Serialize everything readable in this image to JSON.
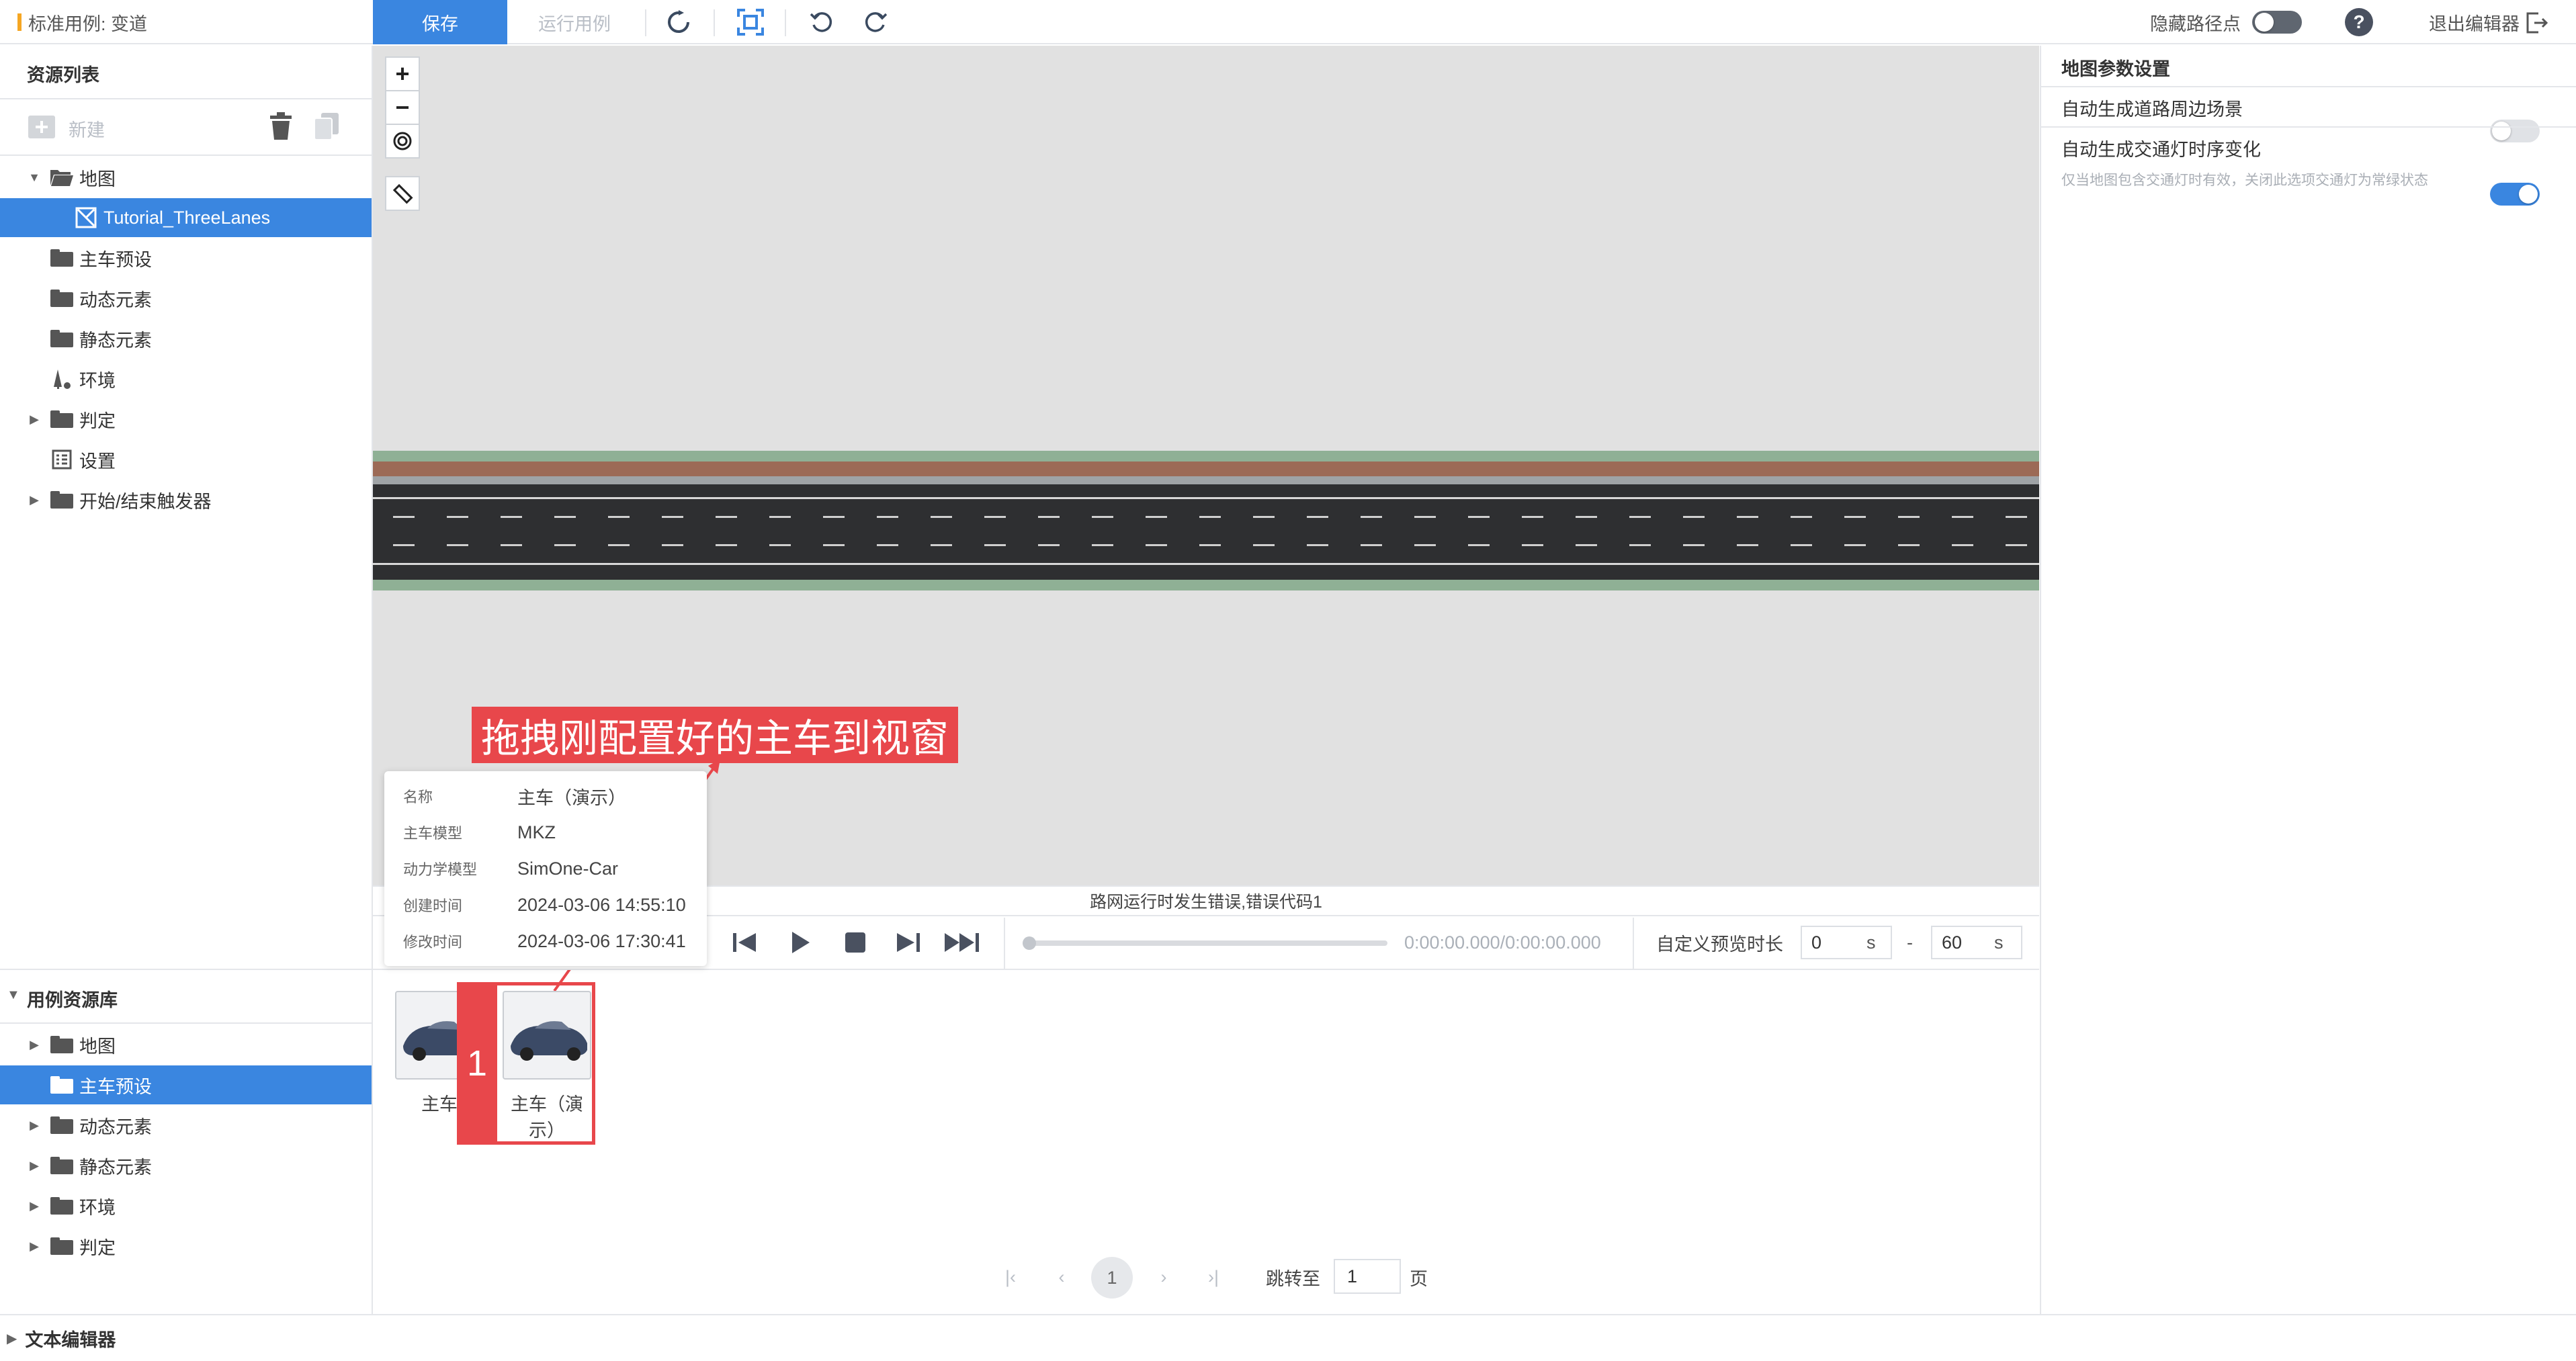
{
  "header": {
    "breadcrumb": "标准用例: 变道",
    "save_label": "保存",
    "run_label": "运行用例",
    "hide_waypoints_label": "隐藏路径点",
    "hide_waypoints_on": false,
    "exit_label": "退出编辑器"
  },
  "resources": {
    "title": "资源列表",
    "new_label": "新建",
    "tree": [
      {
        "label": "地图",
        "expanded": true,
        "icon": "folder-open-icon"
      },
      {
        "label": "Tutorial_ThreeLanes",
        "selected": true,
        "icon": "map-icon"
      },
      {
        "label": "主车预设",
        "icon": "folder-icon"
      },
      {
        "label": "动态元素",
        "icon": "folder-icon"
      },
      {
        "label": "静态元素",
        "icon": "folder-icon"
      },
      {
        "label": "环境",
        "icon": "environment-icon"
      },
      {
        "label": "判定",
        "icon": "folder-icon"
      },
      {
        "label": "设置",
        "icon": "settings-icon"
      },
      {
        "label": "开始/结束触发器",
        "icon": "folder-icon"
      }
    ]
  },
  "library": {
    "title": "用例资源库",
    "tree": [
      {
        "label": "地图"
      },
      {
        "label": "主车预设",
        "selected": true
      },
      {
        "label": "动态元素"
      },
      {
        "label": "静态元素"
      },
      {
        "label": "环境"
      },
      {
        "label": "判定"
      }
    ],
    "assets": [
      {
        "label": "主车"
      },
      {
        "label": "主车（演示）"
      }
    ]
  },
  "viewport": {
    "status_text": "路网运行时发生错误,错误代码1"
  },
  "timeline": {
    "time_text": "0:00:00.000/0:00:00.000",
    "preview_label": "自定义预览时长",
    "start_value": "0",
    "end_value": "60",
    "unit": "s",
    "range_sep": "-",
    "progress": 0
  },
  "info_card": {
    "rows": [
      {
        "key": "名称",
        "value": "主车（演示）"
      },
      {
        "key": "主车模型",
        "value": "MKZ"
      },
      {
        "key": "动力学模型",
        "value": "SimOne-Car"
      },
      {
        "key": "创建时间",
        "value": "2024-03-06 14:55:10"
      },
      {
        "key": "修改时间",
        "value": "2024-03-06 17:30:41"
      }
    ]
  },
  "annotation": {
    "text": "拖拽刚配置好的主车到视窗",
    "step_number": "1"
  },
  "pagination": {
    "current": "1",
    "jump_label": "跳转至",
    "jump_value": "1",
    "page_suffix": "页"
  },
  "map_settings": {
    "title": "地图参数设置",
    "option1_label": "自动生成道路周边场景",
    "option1_on": false,
    "option2_label": "自动生成交通灯时序变化",
    "option2_on": true,
    "option2_hint": "仅当地图包含交通灯时有效，关闭此选项交通灯为常绿状态"
  },
  "footer": {
    "text_editor_label": "文本编辑器"
  },
  "colors": {
    "accent": "#3a86e0",
    "annotation": "#e8474b"
  }
}
